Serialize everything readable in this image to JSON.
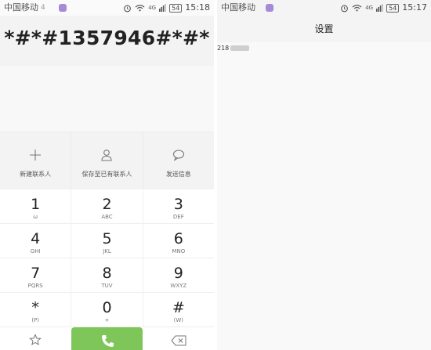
{
  "left_status": {
    "carrier": "中国移动",
    "signal_label": "4",
    "network": "4G",
    "battery": "54",
    "time": "15:18"
  },
  "dialer": {
    "input": "*#*#1357946#*#*",
    "actions": [
      {
        "label": "新建联系人",
        "icon": "plus-icon"
      },
      {
        "label": "保存至已有联系人",
        "icon": "person-icon"
      },
      {
        "label": "发送信息",
        "icon": "message-icon"
      }
    ],
    "keys": [
      [
        {
          "digit": "1",
          "letters": "ω"
        },
        {
          "digit": "2",
          "letters": "ABC"
        },
        {
          "digit": "3",
          "letters": "DEF"
        }
      ],
      [
        {
          "digit": "4",
          "letters": "GHI"
        },
        {
          "digit": "5",
          "letters": "JKL"
        },
        {
          "digit": "6",
          "letters": "MNO"
        }
      ],
      [
        {
          "digit": "7",
          "letters": "PQRS"
        },
        {
          "digit": "8",
          "letters": "TUV"
        },
        {
          "digit": "9",
          "letters": "WXYZ"
        }
      ],
      [
        {
          "digit": "*",
          "letters": "(P)"
        },
        {
          "digit": "0",
          "letters": "+"
        },
        {
          "digit": "#",
          "letters": "(W)"
        }
      ]
    ],
    "bottom": {
      "favorite_icon": "star-icon",
      "call_icon": "phone-icon",
      "delete_icon": "backspace-icon"
    }
  },
  "right_status": {
    "carrier": "中国移动",
    "network": "4G",
    "battery": "54",
    "time": "15:17"
  },
  "settings": {
    "title": "设置",
    "info_prefix": "218"
  },
  "colors": {
    "call_button": "#7ec65a",
    "app_icon": "#a58bd6"
  }
}
